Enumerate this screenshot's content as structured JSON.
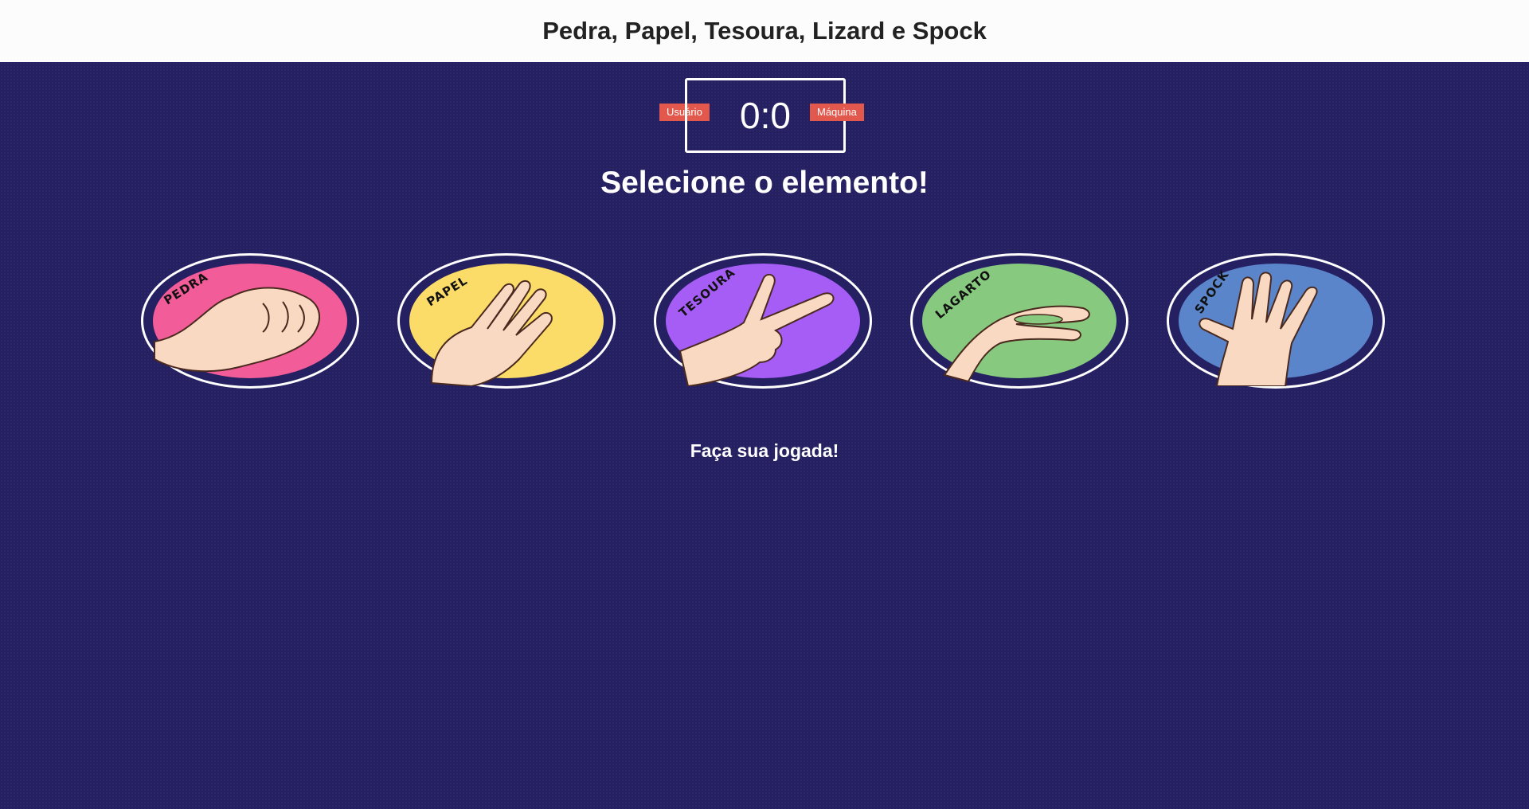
{
  "header": {
    "title": "Pedra, Papel, Tesoura, Lizard e Spock"
  },
  "scoreboard": {
    "user_label": "Usuário",
    "machine_label": "Máquina",
    "score": "0:0"
  },
  "prompt": "Selecione o elemento!",
  "choices": [
    {
      "label": "PEDRA",
      "color": "#f25c98",
      "icon": "rock-fist-icon"
    },
    {
      "label": "PAPEL",
      "color": "#fbdc68",
      "icon": "paper-hand-icon"
    },
    {
      "label": "TESOURA",
      "color": "#a55df5",
      "icon": "scissors-hand-icon"
    },
    {
      "label": "LAGARTO",
      "color": "#87c97f",
      "icon": "lizard-hand-icon"
    },
    {
      "label": "SPOCK",
      "color": "#5b85cb",
      "icon": "spock-hand-icon"
    }
  ],
  "status": "Faça sua jogada!",
  "colors": {
    "background": "#252061",
    "header_bg": "#fcfcfc",
    "badge": "#e2584d"
  }
}
